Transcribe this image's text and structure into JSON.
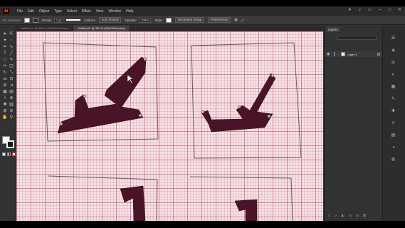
{
  "menu": {
    "logo": "Ai",
    "items": [
      "File",
      "Edit",
      "Object",
      "Type",
      "Select",
      "Effect",
      "View",
      "Window",
      "Help"
    ]
  },
  "control_bar": {
    "selection_label": "No Selection",
    "stroke_label": "Stroke:",
    "brush_label": "Uniform",
    "stroke_style": "5 pt. Round",
    "opacity_label": "Opacity:",
    "opacity_value": "100%",
    "style_label": "Style:",
    "document_setup": "Document Setup",
    "preferences": "Preferences"
  },
  "tabs": [
    {
      "label": "Untitled-1* @ 400 % (CMYK/Preview)",
      "active": false
    },
    {
      "label": "Untitled-2* @ 100 % (CMYK/Preview)",
      "active": true
    }
  ],
  "layers_panel": {
    "tab": "Layers",
    "layer_name": "Layer 1"
  },
  "colors": {
    "accent_layer": "#4c7dff",
    "app_bg": "#323232",
    "shape_fill": "#4a1428"
  }
}
